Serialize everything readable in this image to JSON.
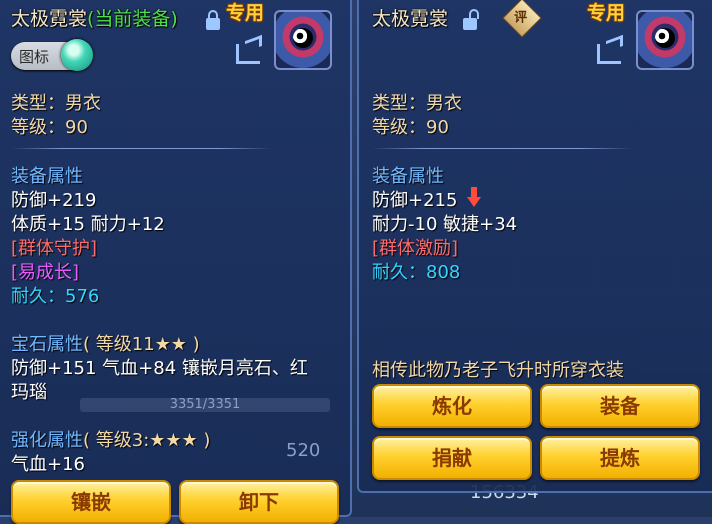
{
  "left": {
    "title": "太极霓裳",
    "title_status": "(当前装备)",
    "special_tag": "专用",
    "icon_toggle_label": "图标",
    "type_line": "类型：男衣",
    "level_line": "等级：90",
    "attr_header": "装备属性",
    "attrs": [
      "防御+219",
      "体质+15 耐力+12"
    ],
    "effect_1": "[群体守护]",
    "effect_2": "[易成长]",
    "durability_label": "耐久：",
    "durability_value": "576",
    "gem_header": "宝石属性",
    "gem_level": "( 等级11★★ )",
    "gem_line_1": "防御+151 气血+84 镶嵌月亮石、红",
    "gem_line_2": "玛瑙",
    "enhance_header": "强化属性",
    "enhance_level": "( 等级3:★★★ )",
    "enhance_line": "气血+16",
    "buttons": [
      "镶嵌",
      "卸下"
    ]
  },
  "right": {
    "title": "太极霓裳",
    "rate_label": "评",
    "special_tag": "专用",
    "type_line": "类型：男衣",
    "level_line": "等级：90",
    "attr_header": "装备属性",
    "attrs": [
      "防御+215",
      "耐力-10 敏捷+34"
    ],
    "effect_1": "[群体激励]",
    "durability_label": "耐久：",
    "durability_value": "808",
    "description": "相传此物乃老子飞升时所穿衣装",
    "buttons": [
      "炼化",
      "装备",
      "捐献",
      "提炼"
    ]
  },
  "background": {
    "hp_bar_text": "3351/3351",
    "stat_value": "520",
    "money_text": "156334"
  },
  "colors": {
    "gold_text": "#f3d8a6",
    "effect_red": "#ff6a6a",
    "effect_pink": "#e85cff",
    "durability_cyan": "#36d4ff",
    "button_gold": "#ffd12e",
    "green_status": "#4ee04a"
  }
}
